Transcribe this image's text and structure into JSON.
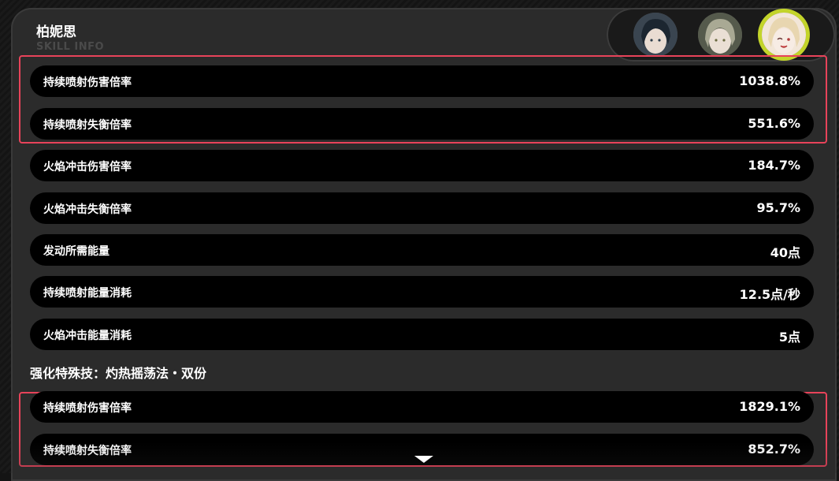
{
  "header": {
    "title": "柏妮思",
    "subtitle": "SKILL INFO"
  },
  "avatars": [
    {
      "name": "avatar-dark-hair",
      "selected": false
    },
    {
      "name": "avatar-silver-hair",
      "selected": false
    },
    {
      "name": "avatar-blonde-hair",
      "selected": true
    }
  ],
  "rows": [
    {
      "label": "持续喷射伤害倍率",
      "value": "1038.8%"
    },
    {
      "label": "持续喷射失衡倍率",
      "value": "551.6%"
    },
    {
      "label": "火焰冲击伤害倍率",
      "value": "184.7%"
    },
    {
      "label": "火焰冲击失衡倍率",
      "value": "95.7%"
    },
    {
      "label": "发动所需能量",
      "value": "40点"
    },
    {
      "label": "持续喷射能量消耗",
      "value": "12.5点/秒"
    },
    {
      "label": "火焰冲击能量消耗",
      "value": "5点"
    }
  ],
  "section": {
    "heading": "强化特殊技：灼热摇荡法・双份",
    "rows": [
      {
        "label": "持续喷射伤害倍率",
        "value": "1829.1%"
      },
      {
        "label": "持续喷射失衡倍率",
        "value": "852.7%"
      }
    ]
  },
  "colors": {
    "highlight": "#e8435a",
    "selected_ring": "#c3d42a",
    "panel": "#2b2b2b",
    "row": "#000000"
  }
}
